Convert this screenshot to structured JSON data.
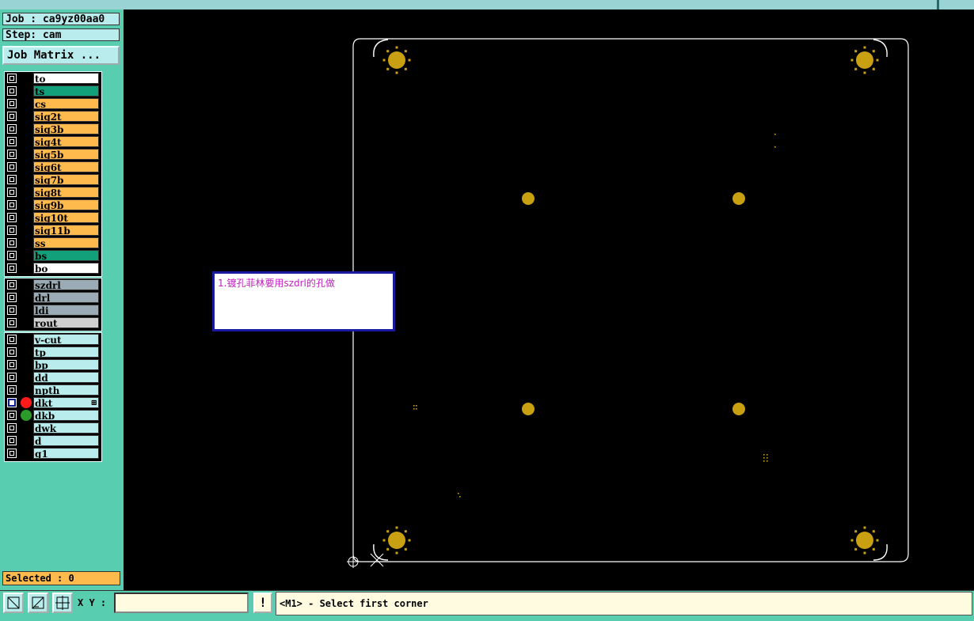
{
  "header": {
    "job": "Job : ca9yz00aa0",
    "step": "Step: cam",
    "job_matrix": "Job Matrix ..."
  },
  "layers": [
    {
      "name": "to",
      "color": "#ffffff"
    },
    {
      "name": "ts",
      "color": "#12a07a"
    },
    {
      "name": "cs",
      "color": "#ffba4d"
    },
    {
      "name": "sig2t",
      "color": "#ffba4d"
    },
    {
      "name": "sig3b",
      "color": "#ffba4d"
    },
    {
      "name": "sig4t",
      "color": "#ffba4d"
    },
    {
      "name": "sig5b",
      "color": "#ffba4d"
    },
    {
      "name": "sig6t",
      "color": "#ffba4d"
    },
    {
      "name": "sig7b",
      "color": "#ffba4d"
    },
    {
      "name": "sig8t",
      "color": "#ffba4d"
    },
    {
      "name": "sig9b",
      "color": "#ffba4d"
    },
    {
      "name": "sig10t",
      "color": "#ffba4d"
    },
    {
      "name": "sig11b",
      "color": "#ffba4d"
    },
    {
      "name": "ss",
      "color": "#ffba4d"
    },
    {
      "name": "bs",
      "color": "#12a07a"
    },
    {
      "name": "bo",
      "color": "#ffffff"
    }
  ],
  "drill_layers": [
    {
      "name": "szdrl",
      "color": "#9aabb5"
    },
    {
      "name": "drl",
      "color": "#9aabb5"
    },
    {
      "name": "ldi",
      "color": "#9aabb5"
    },
    {
      "name": "rout",
      "color": "#d0d0d0"
    }
  ],
  "misc_layers": [
    {
      "name": "v-cut",
      "color": "#b9ecec"
    },
    {
      "name": "tp",
      "color": "#b9ecec"
    },
    {
      "name": "bp",
      "color": "#b9ecec"
    },
    {
      "name": "dd",
      "color": "#b9ecec"
    },
    {
      "name": "npth",
      "color": "#b9ecec"
    },
    {
      "name": "dkt",
      "color": "#b9ecec",
      "selected": true,
      "dot": "#ff1a1a",
      "marker": "⊞"
    },
    {
      "name": "dkb",
      "color": "#b9ecec",
      "dot": "#2a9a2a"
    },
    {
      "name": "dwk",
      "color": "#b9ecec"
    },
    {
      "name": "d",
      "color": "#b9ecec"
    },
    {
      "name": "g1",
      "color": "#b9ecec"
    }
  ],
  "selected": "Selected : 0",
  "note": "1.镀孔菲林要用szdrl的孔做",
  "statusbar": {
    "xy_label": "X Y :",
    "xy_value": "",
    "excl": "!",
    "prompt": "<M1> - Select first corner"
  },
  "colors": {
    "pad": "#c8a012",
    "outline": "#ffffff"
  }
}
